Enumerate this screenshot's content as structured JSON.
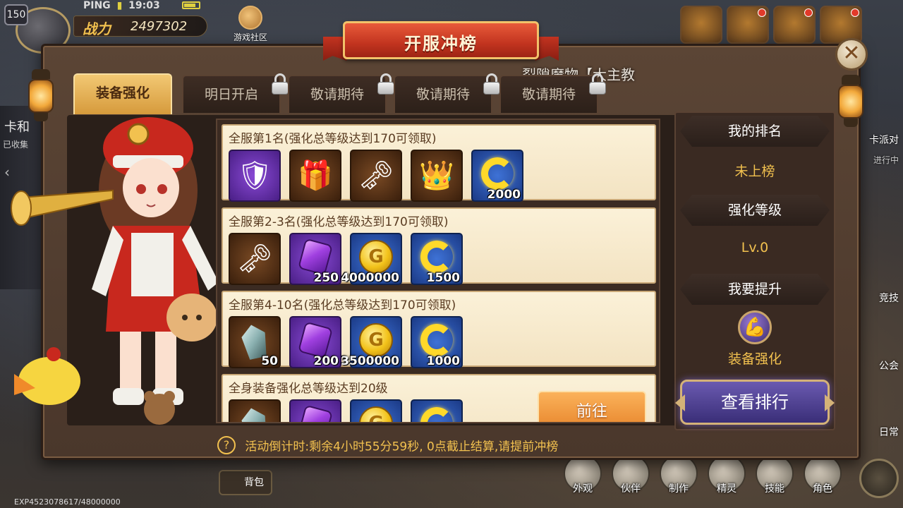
{
  "hud": {
    "level": "150",
    "ping_label": "PING",
    "time": "19:03",
    "power_label": "战力",
    "power_value": "2497302",
    "community_label": "游戏社区",
    "exp_text": "EXP4523078617/48000000",
    "bag_label": "背包",
    "left_strip_title": "卡和",
    "left_strip_sub": "已收集",
    "right_labels": [
      "卡派对",
      "进行中",
      "竞技",
      "公会",
      "日常"
    ],
    "bottom_menu": [
      {
        "label": "外观",
        "icon": "appearance-icon"
      },
      {
        "label": "伙伴",
        "icon": "partner-icon"
      },
      {
        "label": "制作",
        "icon": "craft-icon"
      },
      {
        "label": "精灵",
        "icon": "spirit-icon"
      },
      {
        "label": "技能",
        "icon": "skill-icon"
      },
      {
        "label": "角色",
        "icon": "character-icon"
      }
    ]
  },
  "modal": {
    "title": "开服冲榜",
    "close_symbol": "✕",
    "marquee": "裂隙魔物【大主教",
    "tabs": [
      {
        "label": "装备强化",
        "active": true,
        "locked": false
      },
      {
        "label": "明日开启",
        "active": false,
        "locked": true
      },
      {
        "label": "敬请期待",
        "active": false,
        "locked": true
      },
      {
        "label": "敬请期待",
        "active": false,
        "locked": true
      },
      {
        "label": "敬请期待",
        "active": false,
        "locked": true
      }
    ],
    "tiers": [
      {
        "title": "全服第1名(强化总等级达到170可领取)",
        "items": [
          {
            "icon": "armor-heart-icon",
            "frame": "purple",
            "qty": ""
          },
          {
            "icon": "treasure-chest-icon",
            "frame": "brown",
            "qty": ""
          },
          {
            "icon": "gem-key-icon",
            "frame": "brown",
            "qty": ""
          },
          {
            "icon": "golden-chest-icon",
            "frame": "brown",
            "qty": ""
          },
          {
            "icon": "c-coin-icon",
            "frame": "blue",
            "qty": "2000"
          }
        ]
      },
      {
        "title": "全服第2-3名(强化总等级达到170可领取)",
        "items": [
          {
            "icon": "gem-key-icon",
            "frame": "brown",
            "qty": ""
          },
          {
            "icon": "purple-gem-icon",
            "frame": "purple",
            "qty": "250"
          },
          {
            "icon": "gold-coin-icon",
            "frame": "blue",
            "qty": "4000000"
          },
          {
            "icon": "c-coin-icon",
            "frame": "blue",
            "qty": "1500"
          }
        ]
      },
      {
        "title": "全服第4-10名(强化总等级达到170可领取)",
        "items": [
          {
            "icon": "crystal-icon",
            "frame": "brown",
            "qty": "50"
          },
          {
            "icon": "purple-gem-icon",
            "frame": "purple",
            "qty": "200"
          },
          {
            "icon": "gold-coin-icon",
            "frame": "blue",
            "qty": "3500000"
          },
          {
            "icon": "c-coin-icon",
            "frame": "blue",
            "qty": "1000"
          }
        ]
      },
      {
        "title": "全身装备强化总等级达到20级",
        "items": [
          {
            "icon": "crystal-icon",
            "frame": "brown",
            "qty": ""
          },
          {
            "icon": "purple-gem-icon",
            "frame": "purple",
            "qty": ""
          },
          {
            "icon": "gold-coin-icon",
            "frame": "blue",
            "qty": ""
          },
          {
            "icon": "c-coin-icon",
            "frame": "blue",
            "qty": ""
          }
        ],
        "button": "前往"
      }
    ],
    "right_panel": {
      "my_rank_label": "我的排名",
      "my_rank_value": "未上榜",
      "level_label": "强化等级",
      "level_value": "Lv.0",
      "improve_label": "我要提升",
      "improve_item": "装备强化",
      "view_rank_button": "查看排行"
    },
    "countdown": "活动倒计时:剩余4小时55分59秒, 0点截止结算,请提前冲榜"
  },
  "colors": {
    "accent_gold": "#f2c14f",
    "title_red": "#c2341f",
    "tab_active": "#d69a3c",
    "card_bg": "#f3e3c2",
    "button_orange": "#e6832a",
    "button_purple": "#3a2e78"
  }
}
